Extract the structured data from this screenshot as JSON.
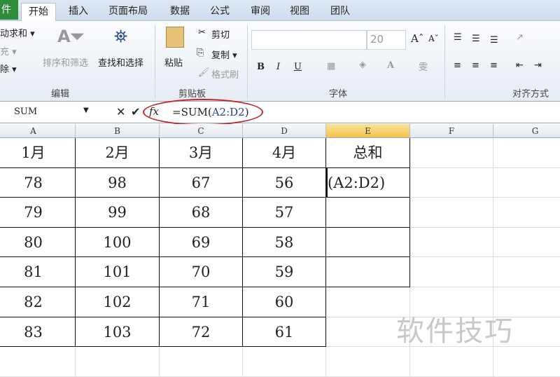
{
  "tabs": {
    "file": "件",
    "items": [
      "开始",
      "插入",
      "页面布局",
      "数据",
      "公式",
      "审阅",
      "视图",
      "团队"
    ]
  },
  "ribbon": {
    "edit": {
      "autosum": "动求和 ▾",
      "fill": "充 ▾",
      "clear": "除 ▾",
      "sort": "排序和筛选",
      "find": "查找和选择",
      "group": "编辑"
    },
    "clipboard": {
      "paste": "粘贴",
      "cut": "剪切",
      "copy": "复制 ▾",
      "format_painter": "格式刷",
      "group": "剪贴板"
    },
    "font": {
      "name": "",
      "size": "20",
      "bold": "B",
      "italic": "I",
      "underline": "U",
      "group": "字体"
    },
    "align": {
      "group": "对齐方式"
    }
  },
  "formula_bar": {
    "name_box": "SUM",
    "formula_prefix": "=SUM(",
    "formula_ref": "A2:D2",
    "formula_suffix": ")",
    "fx": "fx"
  },
  "columns": [
    "A",
    "B",
    "C",
    "D",
    "E",
    "F",
    "G"
  ],
  "rows": [
    [
      "1月",
      "2月",
      "3月",
      "4月",
      "总和"
    ],
    [
      "78",
      "98",
      "67",
      "56",
      "(A2:D2)"
    ],
    [
      "79",
      "99",
      "68",
      "57",
      ""
    ],
    [
      "80",
      "100",
      "69",
      "58",
      ""
    ],
    [
      "81",
      "101",
      "70",
      "59",
      ""
    ],
    [
      "82",
      "102",
      "71",
      "60",
      ""
    ],
    [
      "83",
      "103",
      "72",
      "61",
      ""
    ]
  ],
  "watermark": "软件技巧"
}
